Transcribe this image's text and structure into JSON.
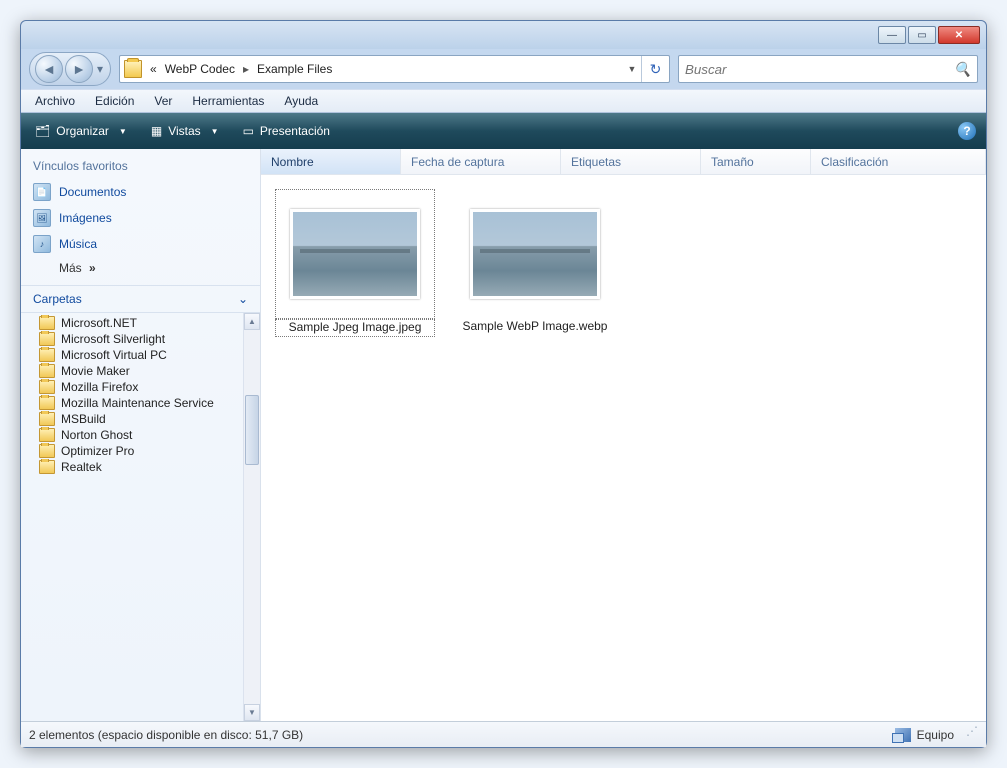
{
  "titlebar": {
    "minimize": "—",
    "maximize": "▭",
    "close": "✕"
  },
  "breadcrumb": {
    "prefix": "«",
    "segments": [
      "WebP Codec",
      "Example Files"
    ]
  },
  "search": {
    "placeholder": "Buscar"
  },
  "menubar": [
    "Archivo",
    "Edición",
    "Ver",
    "Herramientas",
    "Ayuda"
  ],
  "toolbar": {
    "organize": "Organizar",
    "views": "Vistas",
    "slideshow": "Presentación"
  },
  "sidebar": {
    "favorites_header": "Vínculos favoritos",
    "favorites": [
      {
        "label": "Documentos",
        "icon": "document-icon"
      },
      {
        "label": "Imágenes",
        "icon": "pictures-icon"
      },
      {
        "label": "Música",
        "icon": "music-icon"
      }
    ],
    "more": "Más",
    "folders_header": "Carpetas",
    "folders": [
      "Microsoft.NET",
      "Microsoft Silverlight",
      "Microsoft Virtual PC",
      "Movie Maker",
      "Mozilla Firefox",
      "Mozilla Maintenance Service",
      "MSBuild",
      "Norton Ghost",
      "Optimizer Pro",
      "Realtek"
    ]
  },
  "columns": [
    "Nombre",
    "Fecha de captura",
    "Etiquetas",
    "Tamaño",
    "Clasificación"
  ],
  "files": [
    {
      "name": "Sample Jpeg Image.jpeg",
      "selected": true
    },
    {
      "name": "Sample WebP Image.webp",
      "selected": false
    }
  ],
  "statusbar": {
    "left": "2 elementos (espacio disponible en disco: 51,7 GB)",
    "right": "Equipo"
  }
}
